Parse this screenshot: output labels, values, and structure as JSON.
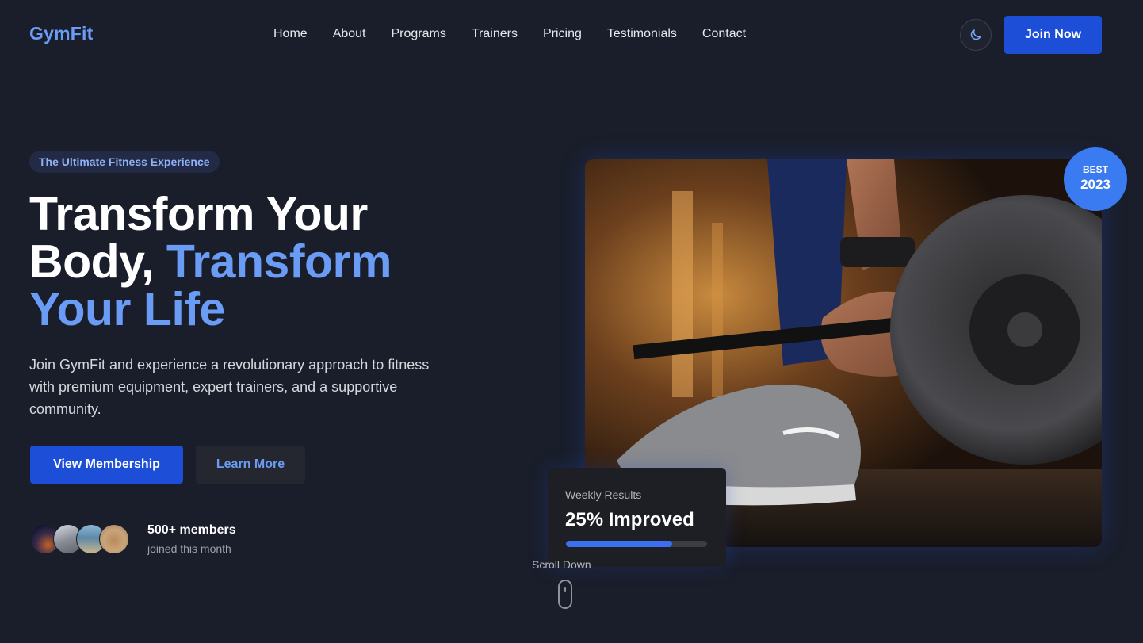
{
  "brand": {
    "logo": "GymFit",
    "accent_color": "#6b9cf5",
    "primary_button_color": "#1d4ed8"
  },
  "nav": {
    "items": [
      "Home",
      "About",
      "Programs",
      "Trainers",
      "Pricing",
      "Testimonials",
      "Contact"
    ],
    "theme_toggle_icon": "moon-icon",
    "join_label": "Join Now"
  },
  "hero": {
    "tagline": "The Ultimate Fitness Experience",
    "headline_part1": "Transform Your Body, ",
    "headline_accent": "Transform Your Life",
    "description": "Join GymFit and experience a revolutionary approach to fitness with premium equipment, expert trainers, and a supportive community.",
    "primary_cta": "View Membership",
    "secondary_cta": "Learn More",
    "members_count": "500+ members",
    "members_sub": "joined this month"
  },
  "badge": {
    "top": "BEST",
    "year": "2023"
  },
  "results_card": {
    "label": "Weekly Results",
    "value": "25% Improved",
    "progress_fraction": 0.75
  },
  "scroll": {
    "label": "Scroll Down"
  }
}
